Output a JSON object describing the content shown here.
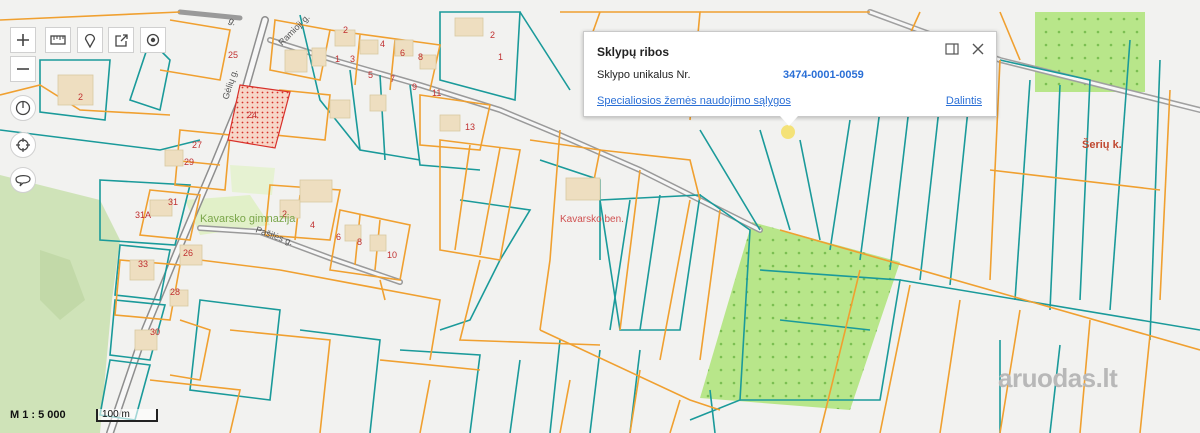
{
  "map": {
    "street_labels": [
      "Ramioji g.",
      "Gėlių g.",
      "Pašilės g.",
      "g."
    ],
    "place_labels": [
      "Kavarsko gimnazija",
      "Kavarsko ben.",
      "Šerių k."
    ],
    "parcel_numbers": [
      "25",
      "2",
      "24",
      "2",
      "1",
      "3",
      "4",
      "6",
      "8",
      "2",
      "1",
      "5",
      "7",
      "9",
      "11",
      "13",
      "27",
      "29",
      "31",
      "31A",
      "33",
      "26",
      "28",
      "30",
      "2",
      "4",
      "6",
      "8",
      "10"
    ],
    "colors": {
      "parcel_orange": "#f0a030",
      "parcel_teal": "#1a9a9a",
      "road": "#8a8a8a",
      "green_forest": "#c8e0b0",
      "green_field": "#b8e68a",
      "hatched_parcel": "#e04030"
    }
  },
  "toolbar": {
    "icons": [
      "zoom-in-icon",
      "measure-icon",
      "location-pin-icon",
      "export-icon",
      "target-icon",
      "zoom-out-icon",
      "power-icon",
      "crosshair-icon",
      "lasso-icon"
    ]
  },
  "popup": {
    "title": "Sklypų ribos",
    "label": "Sklypo unikalus Nr.",
    "value": "3474-0001-0059",
    "link_conditions": "Specialiosios žemės naudojimo sąlygos",
    "link_share": "Dalintis"
  },
  "scale": {
    "ratio_text": "M 1 : 5 000",
    "bar_text": "100 m"
  },
  "watermark": "aruodas.lt"
}
